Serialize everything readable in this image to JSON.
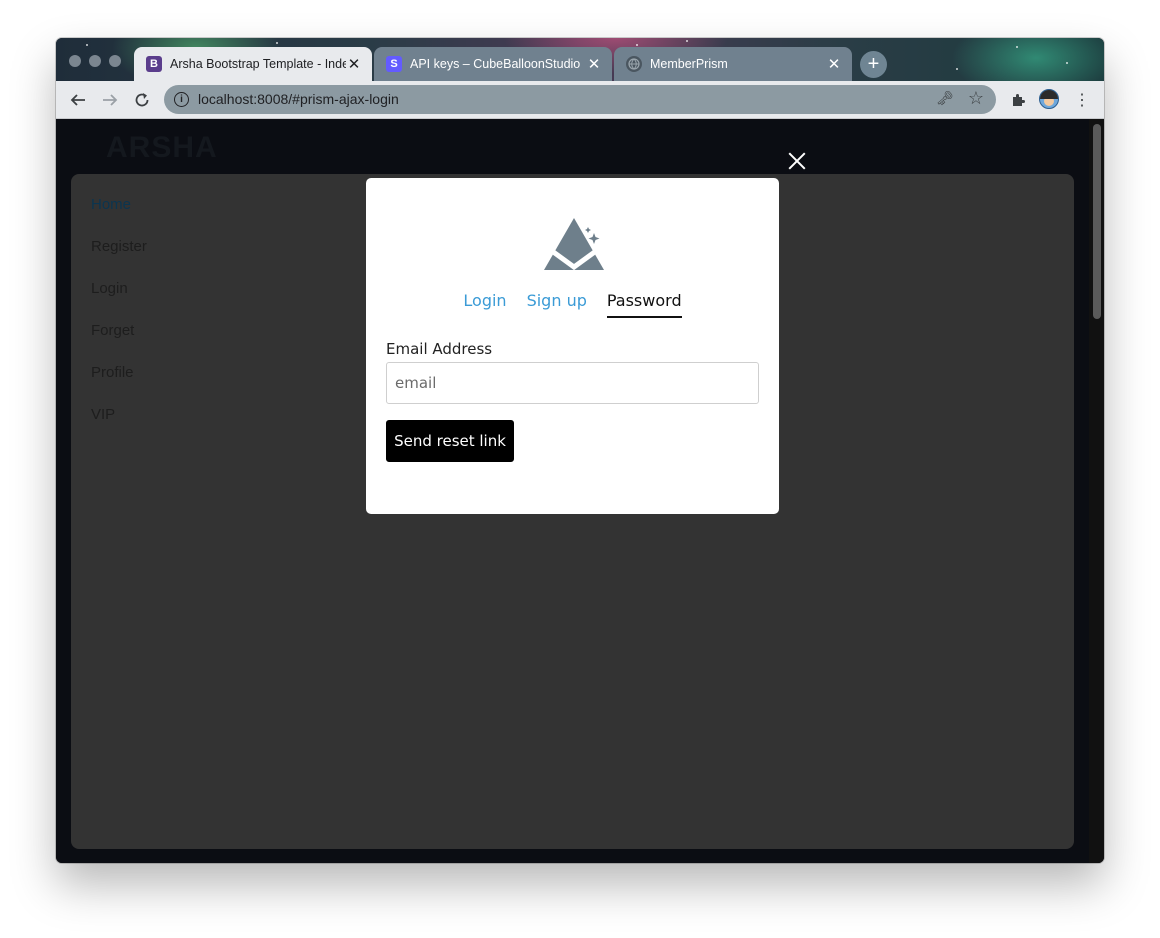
{
  "browser": {
    "tabs": [
      {
        "title": "Arsha Bootstrap Template - Index",
        "favicon": "B",
        "favicon_color": "#5a3d8c",
        "close": "✕"
      },
      {
        "title": "API keys – CubeBalloonStudio",
        "favicon": "S",
        "favicon_color": "#635bff",
        "close": "✕"
      },
      {
        "title": "MemberPrism",
        "favicon": "globe-icon",
        "close": "✕"
      }
    ],
    "new_tab": "+",
    "url": "localhost:8008/#prism-ajax-login"
  },
  "page": {
    "brand": "ARSHA",
    "nav_items": [
      "Home",
      "Register",
      "Login",
      "Forget",
      "Profile",
      "VIP"
    ]
  },
  "modal": {
    "tabs": [
      "Login",
      "Sign up",
      "Password"
    ],
    "active_tab": "Password",
    "email_label": "Email Address",
    "email_placeholder": "email",
    "email_value": "",
    "submit_label": "Send reset link"
  },
  "colors": {
    "accent_link": "#3b9bd6",
    "button_bg": "#000000"
  }
}
